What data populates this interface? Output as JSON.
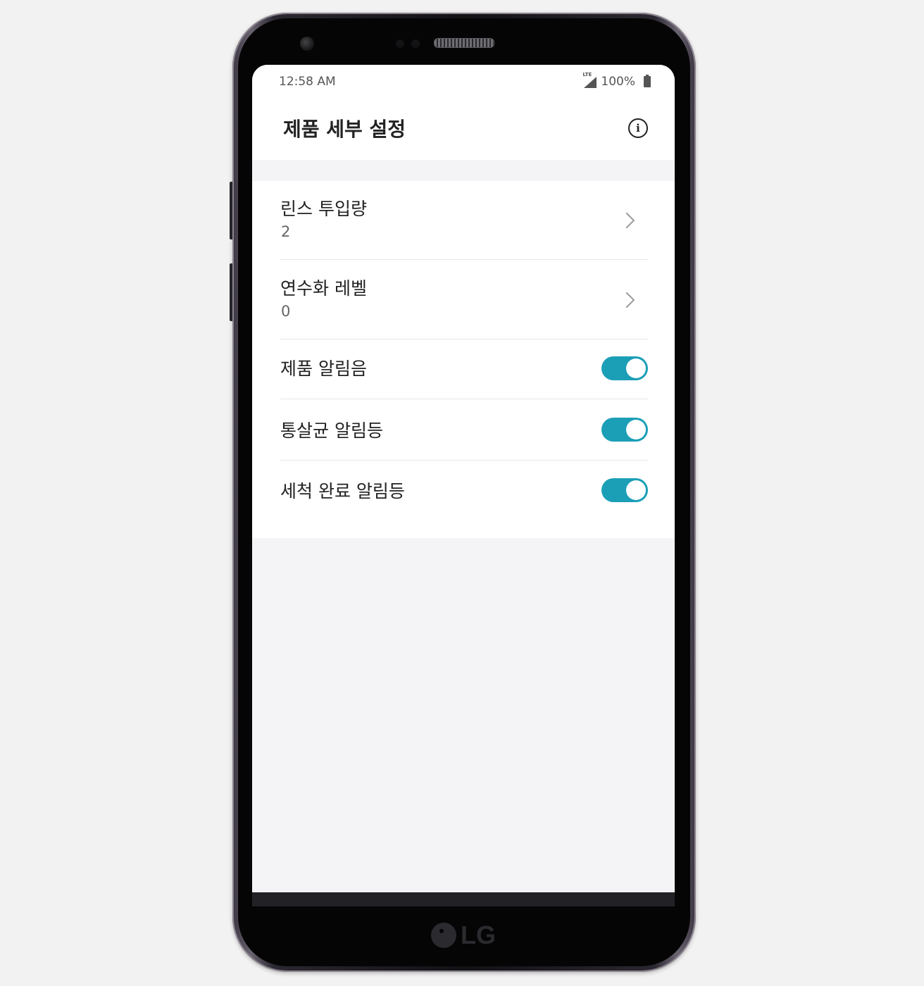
{
  "status_bar": {
    "time": "12:58 AM",
    "network": "LTE",
    "battery": "100%"
  },
  "header": {
    "title": "제품 세부 설정",
    "info_icon": "info-circle-icon"
  },
  "settings": [
    {
      "label": "린스 투입량",
      "value": "2",
      "control": "chevron"
    },
    {
      "label": "연수화 레벨",
      "value": "0",
      "control": "chevron"
    },
    {
      "label": "제품 알림음",
      "control": "toggle",
      "on": true
    },
    {
      "label": "통살균 알림등",
      "control": "toggle",
      "on": true
    },
    {
      "label": "세척 완료 알림등",
      "control": "toggle",
      "on": true
    }
  ],
  "device": {
    "brand": "LG"
  },
  "colors": {
    "toggle_on": "#1b9fb7",
    "background": "#f4f4f6"
  }
}
